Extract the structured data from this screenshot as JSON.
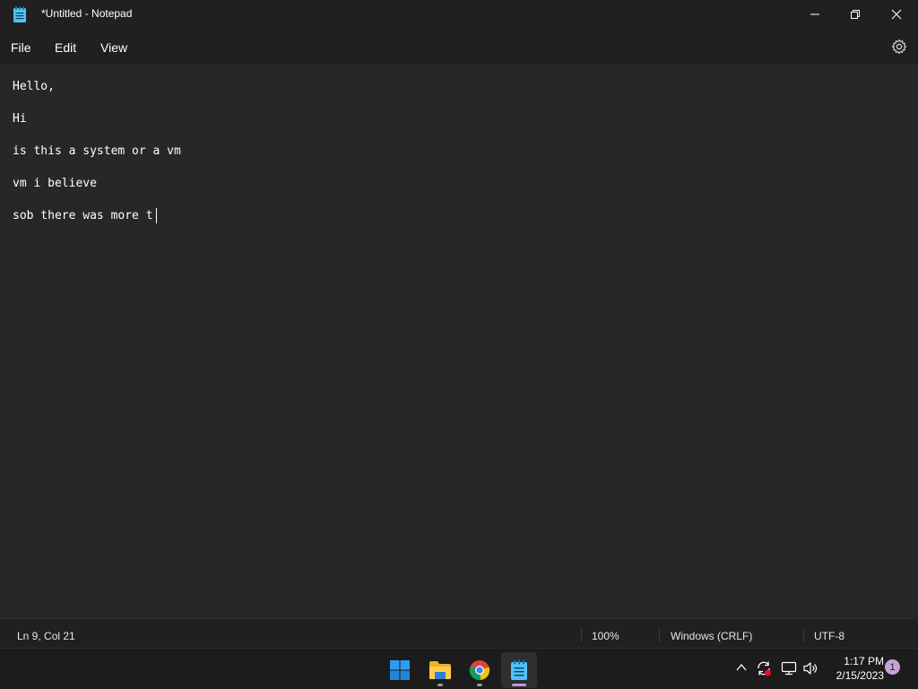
{
  "window": {
    "title": "*Untitled - Notepad"
  },
  "menu": {
    "file": "File",
    "edit": "Edit",
    "view": "View"
  },
  "document": {
    "lines": [
      "Hello,",
      "Hi",
      "is this a system or a vm",
      "vm i believe",
      "sob there was more t"
    ]
  },
  "status": {
    "position": "Ln 9, Col 21",
    "zoom": "100%",
    "line_ending": "Windows (CRLF)",
    "encoding": "UTF-8"
  },
  "taskbar": {
    "apps": [
      "start-icon",
      "file-explorer-icon",
      "chrome-icon",
      "notepad-icon"
    ],
    "time": "1:17 PM",
    "date": "2/15/2023",
    "notification_count": "1"
  },
  "colors": {
    "background": "#202020",
    "editor_background": "#272727",
    "start_blue": "#2b9cf2",
    "notepad_accent": "#4fc3f7"
  }
}
